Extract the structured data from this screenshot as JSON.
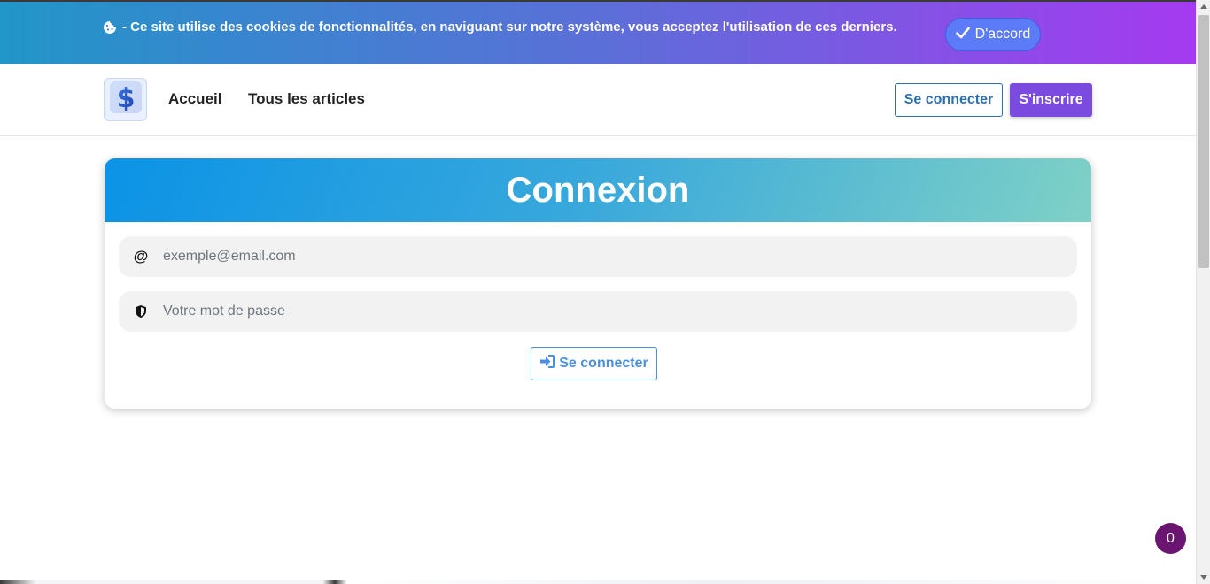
{
  "cookie_banner": {
    "message": "- Ce site utilise des cookies de fonctionnalités, en naviguant sur notre système, vous acceptez l'utilisation de ces derniers.",
    "accept_label": "D'accord",
    "icon": "cookie-icon",
    "accept_icon": "check-icon"
  },
  "navbar": {
    "logo_icon": "dollar-logo-icon",
    "links": [
      {
        "label": "Accueil"
      },
      {
        "label": "Tous les articles"
      }
    ],
    "login_label": "Se connecter",
    "register_label": "S'inscrire"
  },
  "login_card": {
    "title": "Connexion",
    "email": {
      "icon_text": "@",
      "placeholder": "exemple@email.com",
      "value": ""
    },
    "password": {
      "icon": "shield-icon",
      "placeholder": "Votre mot de passe",
      "value": ""
    },
    "submit_label": "Se connecter",
    "submit_icon": "sign-in-icon"
  },
  "counter_badge": "0",
  "colors": {
    "cookie_gradient_start": "#2196c8",
    "cookie_gradient_end": "#a53af0",
    "accept_button": "#5b7cf6",
    "register_button": "#7b4be0",
    "login_outline": "#2a6fb0",
    "card_header_start": "#0b93e6",
    "card_header_end": "#7fd1c6",
    "submit_outline": "#4a90e2",
    "badge": "#6a1670"
  }
}
